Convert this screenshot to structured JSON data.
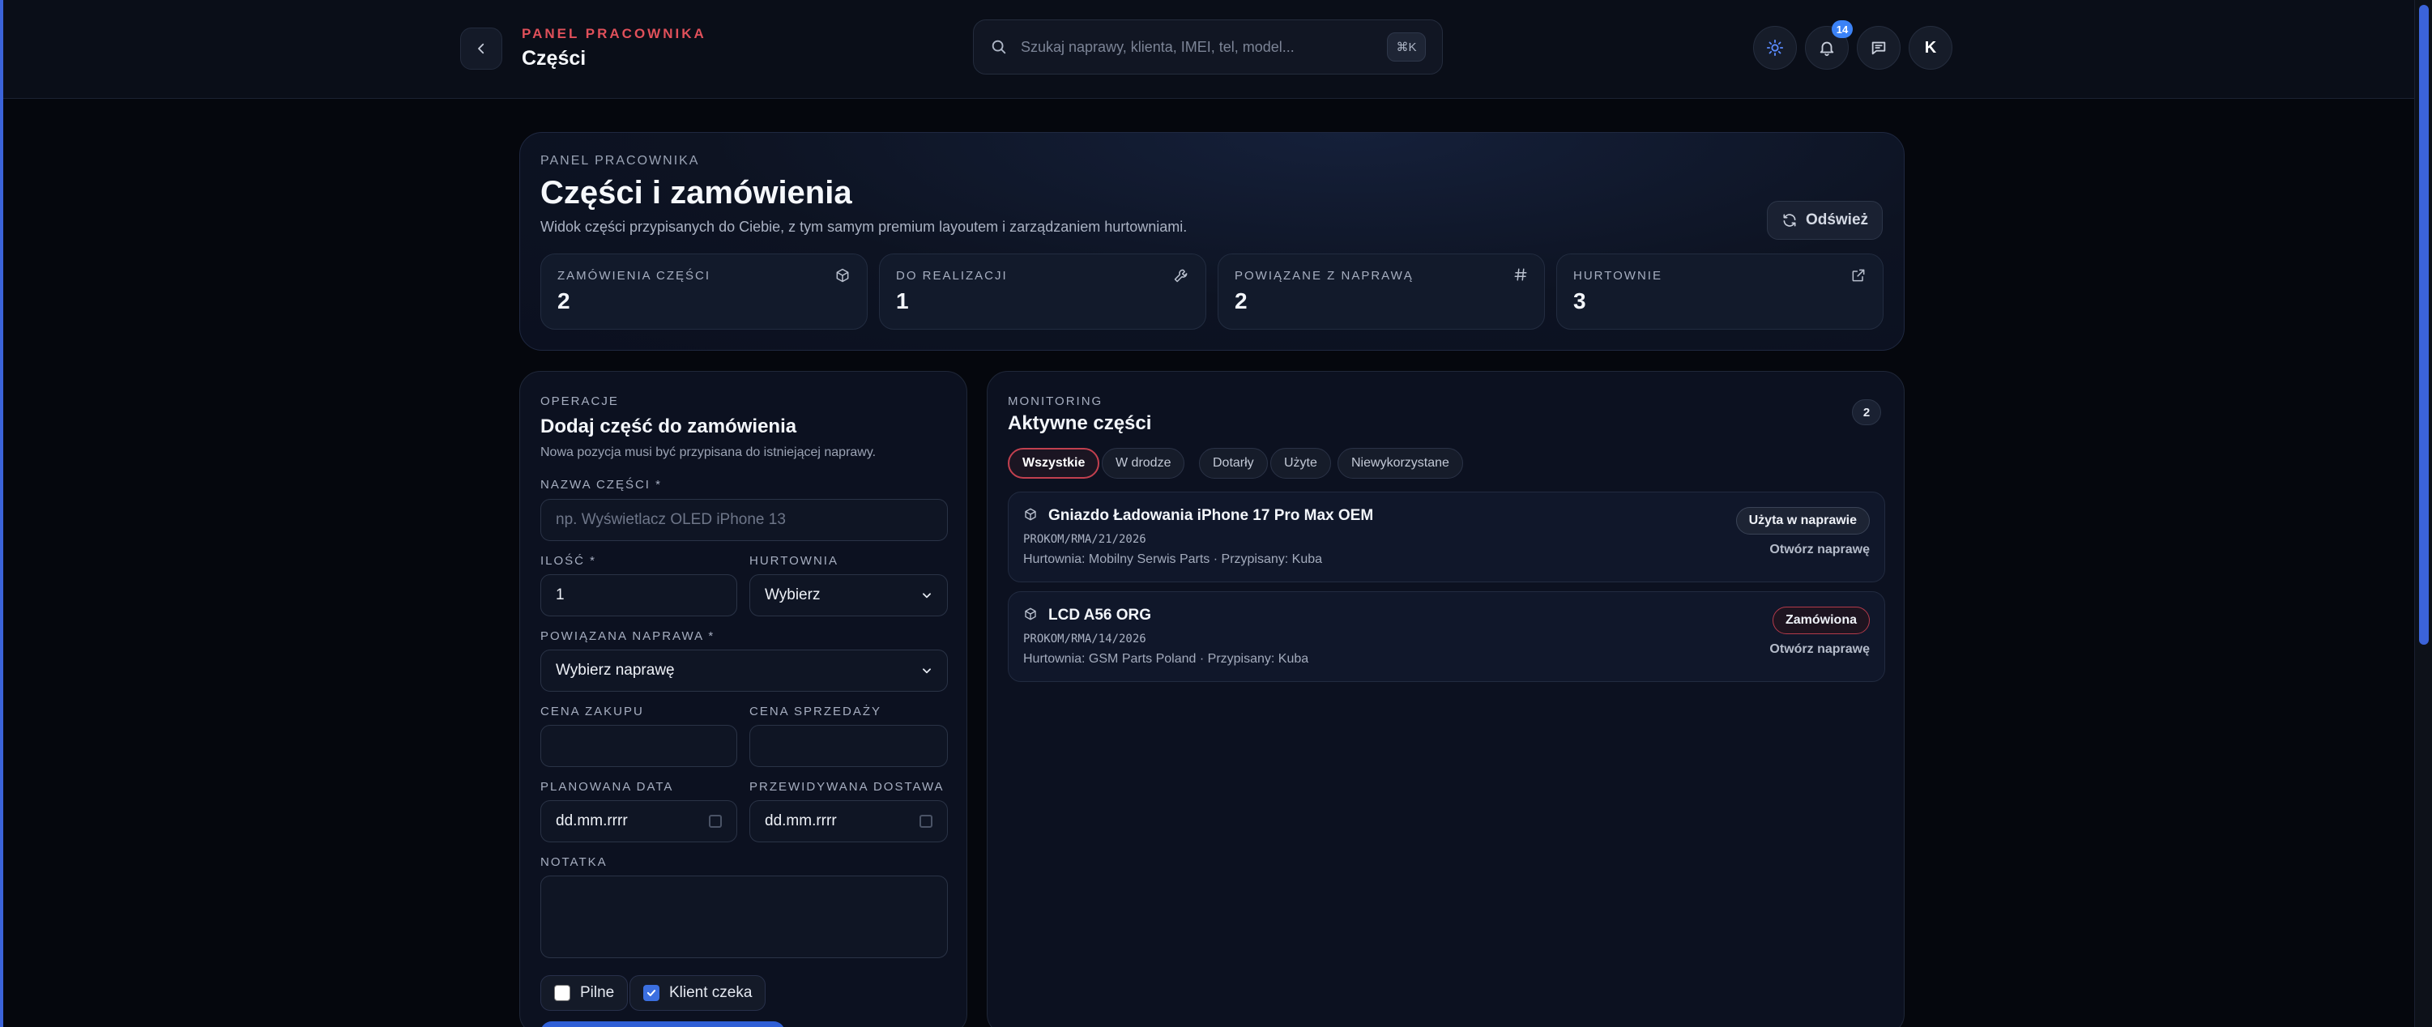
{
  "header": {
    "kicker": "PANEL PRACOWNIKA",
    "title": "Części",
    "search_placeholder": "Szukaj naprawy, klienta, IMEI, tel, model...",
    "shortcut": "⌘K",
    "notifications_count": "14",
    "avatar_letter": "K"
  },
  "hero": {
    "kicker": "PANEL PRACOWNIKA",
    "title": "Części i zamówienia",
    "subtitle": "Widok części przypisanych do Ciebie, z tym samym premium layoutem i zarządzaniem hurtowniami.",
    "refresh_label": "Odśwież",
    "stats": [
      {
        "label": "ZAMÓWIENIA CZĘŚCI",
        "value": "2",
        "icon": "box-icon"
      },
      {
        "label": "DO REALIZACJI",
        "value": "1",
        "icon": "wrench-icon"
      },
      {
        "label": "POWIĄZANE Z NAPRAWĄ",
        "value": "2",
        "icon": "hash-icon"
      },
      {
        "label": "HURTOWNIE",
        "value": "3",
        "icon": "external-link-icon"
      }
    ]
  },
  "form": {
    "kicker": "OPERACJE",
    "title": "Dodaj część do zamówienia",
    "subtitle": "Nowa pozycja musi być przypisana do istniejącej naprawy.",
    "part_name_label": "NAZWA CZĘŚCI *",
    "part_name_placeholder": "np. Wyświetlacz OLED iPhone 13",
    "qty_label": "ILOŚĆ *",
    "qty_value": "1",
    "wholesaler_label": "HURTOWNIA",
    "wholesaler_value": "Wybierz",
    "repair_label": "POWIĄZANA NAPRAWA *",
    "repair_value": "Wybierz naprawę",
    "buy_price_label": "CENA ZAKUPU",
    "sell_price_label": "CENA SPRZEDAŻY",
    "planned_date_label": "PLANOWANA DATA",
    "planned_date_value": "dd.mm.rrrr",
    "delivery_label": "PRZEWIDYWANA DOSTAWA",
    "delivery_value": "dd.mm.rrrr",
    "note_label": "NOTATKA",
    "urgent_label": "Pilne",
    "urgent_checked": false,
    "client_waiting_label": "Klient czeka",
    "client_waiting_checked": true
  },
  "monitoring": {
    "kicker": "MONITORING",
    "title": "Aktywne części",
    "count": "2",
    "tabs": [
      "Wszystkie",
      "W drodze",
      "Dotarły",
      "Użyte",
      "Niewykorzystane"
    ],
    "items": [
      {
        "name": "Gniazdo Ładowania iPhone 17 Pro Max OEM",
        "code": "PROKOM/RMA/21/2026",
        "meta": "Hurtownia: Mobilny Serwis Parts · Przypisany: Kuba",
        "status": "Użyta w naprawie",
        "open_label": "Otwórz naprawę"
      },
      {
        "name": "LCD A56 ORG",
        "code": "PROKOM/RMA/14/2026",
        "meta": "Hurtownia: GSM Parts Poland · Przypisany: Kuba",
        "status": "Zamówiona",
        "open_label": "Otwórz naprawę"
      }
    ]
  },
  "colors": {
    "accent": "#3b63d9",
    "danger": "#e0505a",
    "background": "#05070d"
  }
}
